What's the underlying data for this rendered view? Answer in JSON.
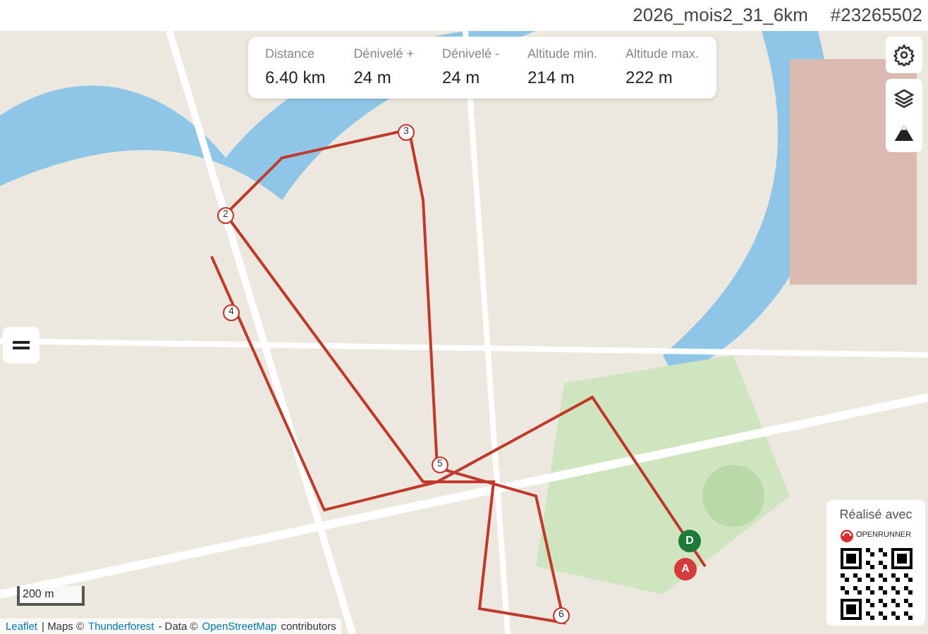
{
  "header": {
    "title": "2026_mois2_31_6km",
    "id": "#23265502"
  },
  "stats": [
    {
      "label": "Distance",
      "value": "6.40 km"
    },
    {
      "label": "Dénivelé +",
      "value": "24 m"
    },
    {
      "label": "Dénivelé -",
      "value": "24 m"
    },
    {
      "label": "Altitude min.",
      "value": "214 m"
    },
    {
      "label": "Altitude max.",
      "value": "222 m"
    }
  ],
  "km_markers": [
    "2",
    "3",
    "4",
    "5",
    "6"
  ],
  "route_markers": [
    {
      "label": "D",
      "color": "#1f7a3a"
    },
    {
      "label": "A",
      "color": "#d63b3b"
    }
  ],
  "scale": "200 m",
  "attribution": {
    "leaflet": "Leaflet",
    "maps": "| Maps ©",
    "thunderforest": "Thunderforest",
    "data": "- Data ©",
    "osm": "OpenStreetMap",
    "contributors": "contributors"
  },
  "badge": {
    "caption": "Réalisé avec",
    "brand": "OPENRUNNER"
  }
}
